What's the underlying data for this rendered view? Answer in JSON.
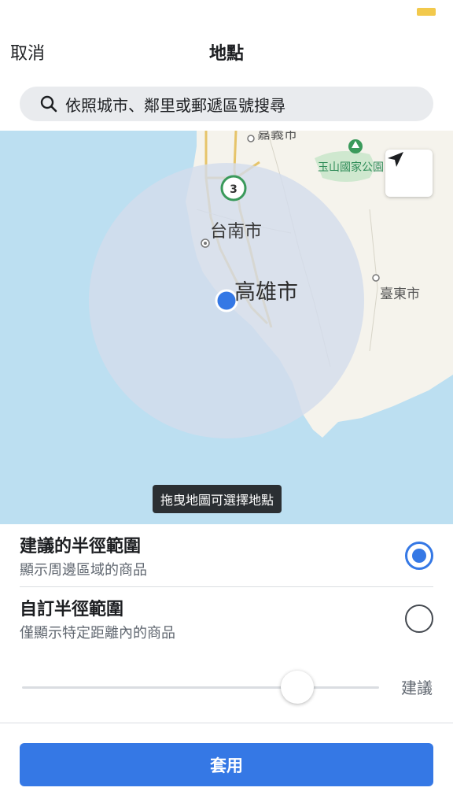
{
  "nav": {
    "cancel_label": "取消",
    "title": "地點"
  },
  "search": {
    "placeholder": "依照城市、鄰里或郵遞區號搜尋",
    "icon": "search-icon"
  },
  "map": {
    "labels": {
      "chiayi": "嘉義市",
      "park": "玉山國家公園",
      "tainan": "台南市",
      "kaohsiung": "高雄市",
      "taitung": "臺東市",
      "marker_number": "3"
    },
    "hint": "拖曳地圖可選擇地點",
    "locate_icon": "location-arrow-icon",
    "colors": {
      "sea": "#bcdff1",
      "land": "#f5f3ec",
      "radius": "#d3dcec",
      "dot": "#3578e5"
    }
  },
  "options": [
    {
      "title": "建議的半徑範圍",
      "subtitle": "顯示周邊區域的商品",
      "selected": true
    },
    {
      "title": "自訂半徑範圍",
      "subtitle": "僅顯示特定距離內的商品",
      "selected": false
    }
  ],
  "slider": {
    "label": "建議",
    "value_fraction": 0.77
  },
  "apply_label": "套用",
  "colors": {
    "accent": "#3578e5"
  }
}
